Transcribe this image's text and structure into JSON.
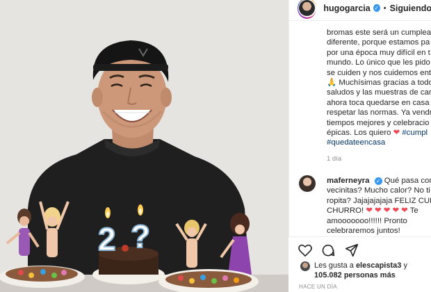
{
  "header": {
    "username": "hugogarcia",
    "follow_status": "Siguiendo",
    "separator": "•"
  },
  "caption": {
    "lines": [
      "bromas este será un cumplea",
      "diferente, porque estamos pa",
      "por una época muy difícil en t",
      "mundo. Lo único que les pido",
      "se cuiden y nos cuidemos ent",
      "Muchísimas gracias a todo",
      "saludos y las muestras de cari",
      "ahora toca quedarse en casa y",
      "respetar las normas. Ya vendrá",
      "tiempos mejores y celebracio",
      "épicas. Los quiero"
    ],
    "pray_emoji": "🙏",
    "heart_emoji": "❤",
    "hashtag_1": "#cumpl",
    "hashtag_2": "#quedateencasa",
    "time_ago": "1 día"
  },
  "comment": {
    "username": "maferneyra",
    "line_1_text": "Qué pasa con",
    "line_2": "vecinitas? Mucho calor? No ti",
    "line_3": "ropita? Jajajajajaja FELIZ CUM",
    "line_4_text": "CHURRO!",
    "hearts": "❤ ❤ ❤ ❤ ❤",
    "line_4_end": "Te",
    "line_5": "amooooooo!!!!!! Pronto",
    "line_6": "celebraremos juntos!"
  },
  "likes": {
    "prefix": "Les gusta a",
    "user": "elescapista3",
    "connector": "y",
    "count": "105.082 personas más"
  },
  "posted": "HACE UN DÍA",
  "icons": [
    "heart-icon",
    "comment-icon",
    "share-icon",
    "verified-icon"
  ],
  "colors": {
    "verified": "#3897f0",
    "hashtag": "#00376b",
    "heart": "#ed4956",
    "muted": "#8e8e8e"
  },
  "photo": {
    "candle_digits": [
      "2",
      "?"
    ]
  }
}
